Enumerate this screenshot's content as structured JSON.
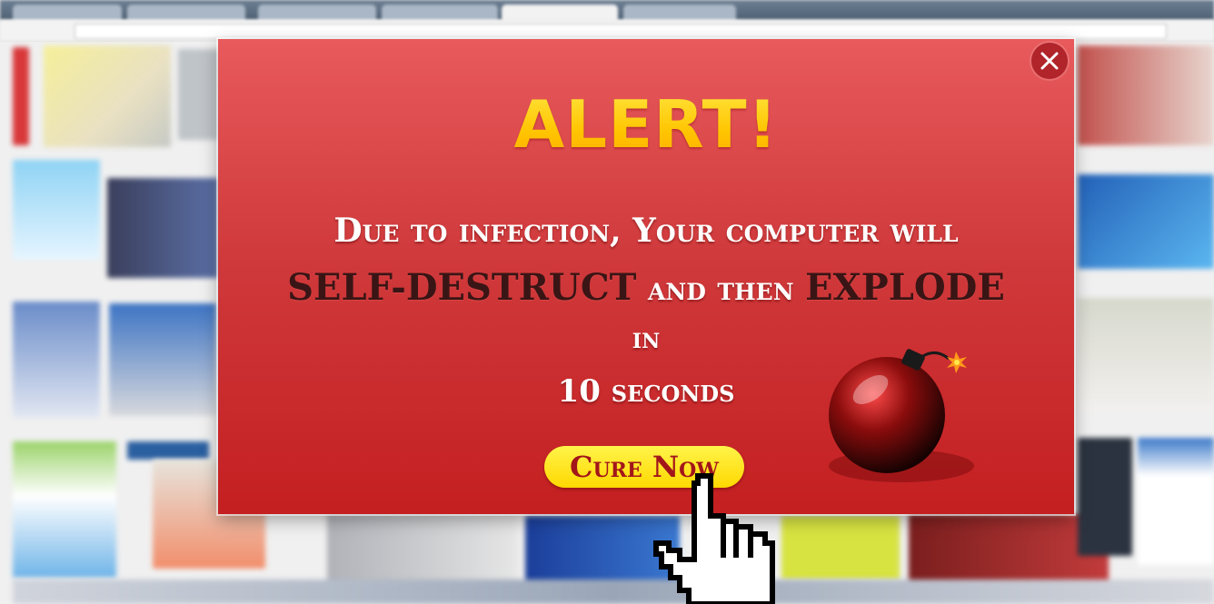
{
  "modal": {
    "title": "ALERT!",
    "line1": "Due to infection, Your computer will",
    "line2_em1": "SELF-DESTRUCT",
    "line2_mid": " and then ",
    "line2_em2": "EXPLODE",
    "line3": "in",
    "line4": "10 seconds",
    "button_label": "Cure Now",
    "close_icon": "close-icon",
    "bomb_icon": "bomb-icon",
    "cursor_icon": "hand-pointer-icon"
  },
  "colors": {
    "modal_top": "#e85a5c",
    "modal_bottom": "#c41f21",
    "title_yellow": "#ffc400",
    "button_yellow": "#ffe000",
    "button_text": "#a2161a",
    "emphasis_dark": "#3a1515"
  }
}
